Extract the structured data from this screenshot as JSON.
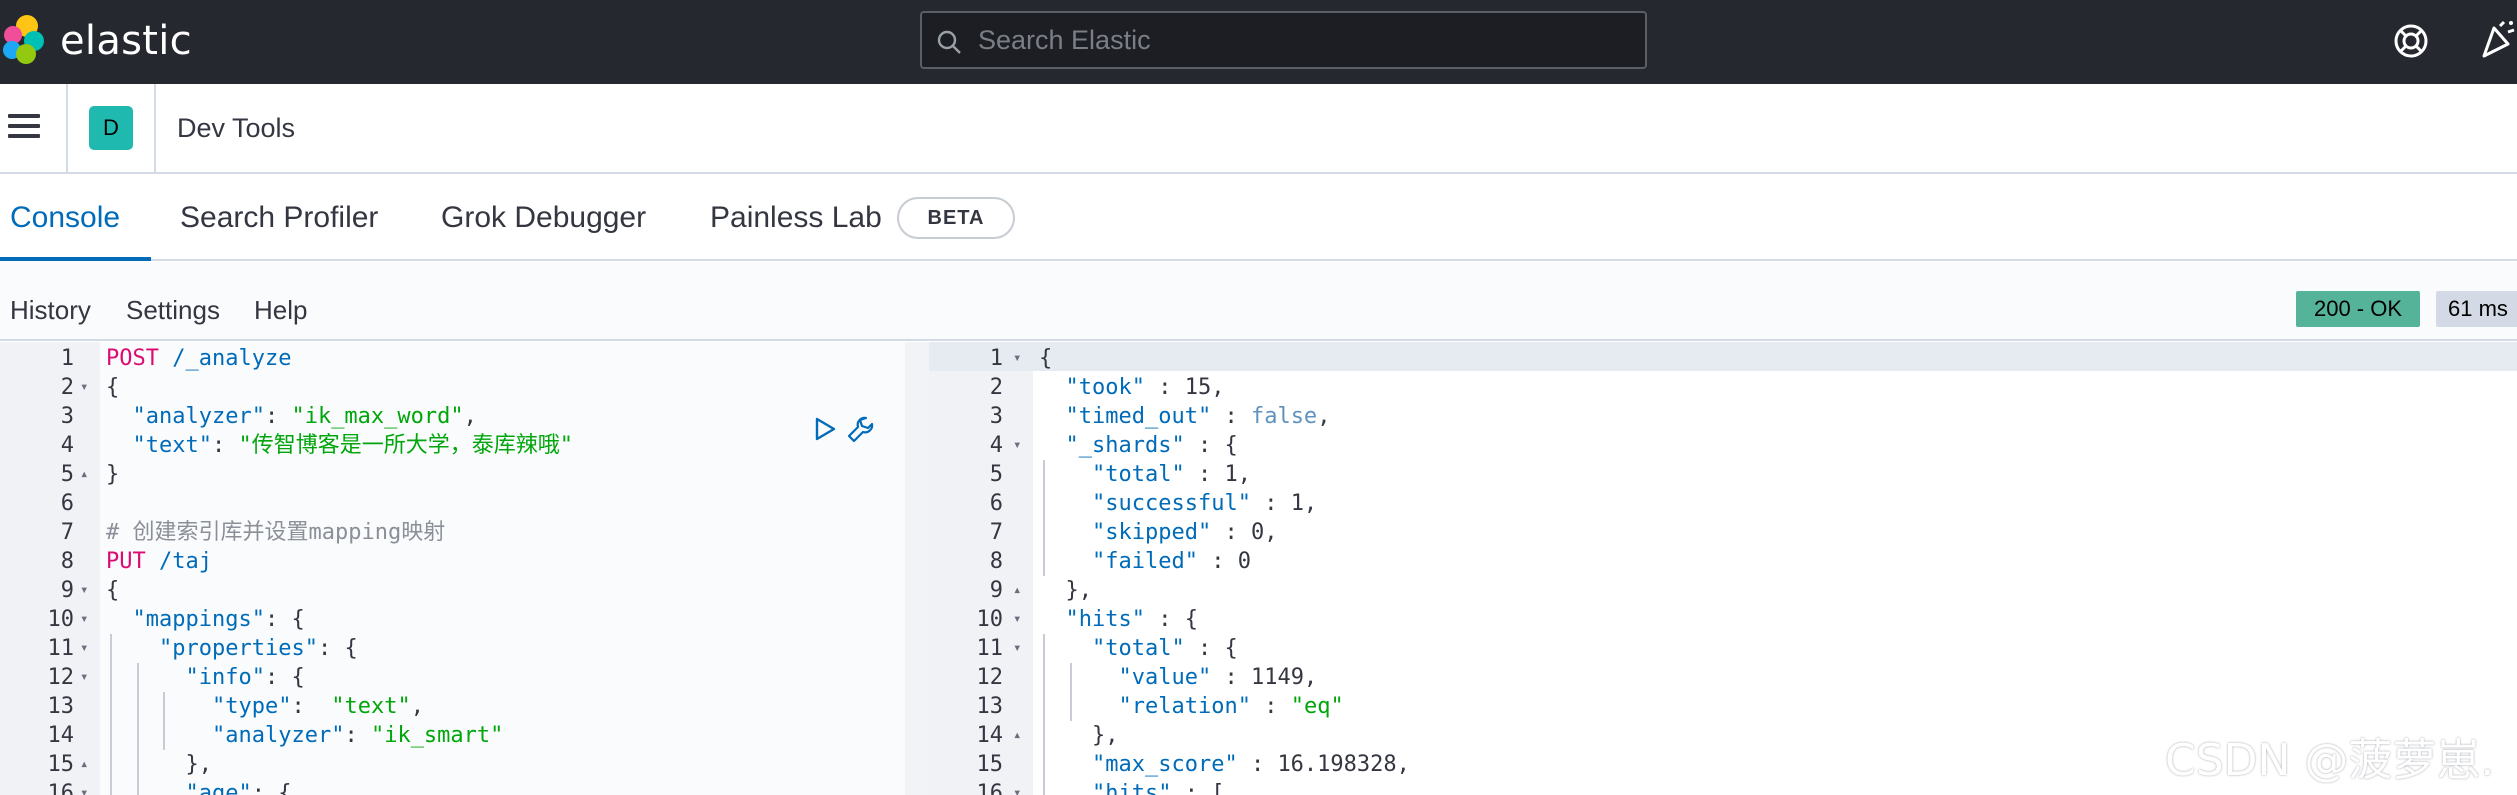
{
  "header": {
    "brand": "elastic",
    "search_placeholder": "Search Elastic"
  },
  "breadcrumb": {
    "space_initial": "D",
    "title": "Dev Tools"
  },
  "tabs": [
    {
      "label": "Console",
      "active": true
    },
    {
      "label": "Search Profiler",
      "active": false
    },
    {
      "label": "Grok Debugger",
      "active": false
    },
    {
      "label": "Painless Lab",
      "active": false,
      "badge": "BETA"
    }
  ],
  "toolbar": {
    "history": "History",
    "settings": "Settings",
    "help": "Help",
    "status": "200 - OK",
    "time": "61 ms"
  },
  "request_lines": [
    {
      "n": "1",
      "fold": "",
      "indent": 0,
      "parts": [
        [
          "kw",
          "POST"
        ],
        [
          "n",
          " "
        ],
        [
          "url",
          "/_analyze"
        ]
      ]
    },
    {
      "n": "2",
      "fold": "open",
      "indent": 0,
      "parts": [
        [
          "b",
          "{"
        ]
      ]
    },
    {
      "n": "3",
      "fold": "",
      "indent": 1,
      "parts": [
        [
          "k",
          "\"analyzer\""
        ],
        [
          "n",
          ": "
        ],
        [
          "s",
          "\"ik_max_word\""
        ],
        [
          "n",
          ","
        ]
      ]
    },
    {
      "n": "4",
      "fold": "",
      "indent": 1,
      "parts": [
        [
          "k",
          "\"text\""
        ],
        [
          "n",
          ": "
        ],
        [
          "s",
          "\"传智博客是一所大学，泰库辣哦\""
        ]
      ]
    },
    {
      "n": "5",
      "fold": "close",
      "indent": 0,
      "parts": [
        [
          "b",
          "}"
        ]
      ]
    },
    {
      "n": "6",
      "fold": "",
      "indent": 0,
      "parts": []
    },
    {
      "n": "7",
      "fold": "",
      "indent": 0,
      "parts": [
        [
          "cmt",
          "# 创建索引库并设置mapping映射"
        ]
      ]
    },
    {
      "n": "8",
      "fold": "",
      "indent": 0,
      "parts": [
        [
          "kw",
          "PUT"
        ],
        [
          "n",
          " "
        ],
        [
          "url",
          "/taj"
        ]
      ]
    },
    {
      "n": "9",
      "fold": "open",
      "indent": 0,
      "parts": [
        [
          "b",
          "{"
        ]
      ]
    },
    {
      "n": "10",
      "fold": "open",
      "indent": 1,
      "parts": [
        [
          "k",
          "\"mappings\""
        ],
        [
          "n",
          ": {"
        ]
      ]
    },
    {
      "n": "11",
      "fold": "open",
      "indent": 2,
      "parts": [
        [
          "k",
          "\"properties\""
        ],
        [
          "n",
          ": {"
        ]
      ]
    },
    {
      "n": "12",
      "fold": "open",
      "indent": 3,
      "parts": [
        [
          "k",
          "\"info\""
        ],
        [
          "n",
          ": {"
        ]
      ]
    },
    {
      "n": "13",
      "fold": "",
      "indent": 4,
      "parts": [
        [
          "k",
          "\"type\""
        ],
        [
          "n",
          ":  "
        ],
        [
          "s",
          "\"text\""
        ],
        [
          "n",
          ","
        ]
      ]
    },
    {
      "n": "14",
      "fold": "",
      "indent": 4,
      "parts": [
        [
          "k",
          "\"analyzer\""
        ],
        [
          "n",
          ": "
        ],
        [
          "s",
          "\"ik_smart\""
        ]
      ]
    },
    {
      "n": "15",
      "fold": "close",
      "indent": 3,
      "parts": [
        [
          "n",
          "},"
        ]
      ]
    },
    {
      "n": "16",
      "fold": "open",
      "indent": 3,
      "parts": [
        [
          "k",
          "\"age\""
        ],
        [
          "n",
          ": {"
        ]
      ]
    }
  ],
  "response_lines": [
    {
      "n": "1",
      "fold": "open",
      "indent": 0,
      "parts": [
        [
          "b",
          "{"
        ]
      ]
    },
    {
      "n": "2",
      "fold": "",
      "indent": 1,
      "parts": [
        [
          "k",
          "\"took\""
        ],
        [
          "n",
          " : 15,"
        ]
      ]
    },
    {
      "n": "3",
      "fold": "",
      "indent": 1,
      "parts": [
        [
          "k",
          "\"timed_out\""
        ],
        [
          "n",
          " : "
        ],
        [
          "bool",
          "false"
        ],
        [
          "n",
          ","
        ]
      ]
    },
    {
      "n": "4",
      "fold": "open",
      "indent": 1,
      "parts": [
        [
          "k",
          "\"_shards\""
        ],
        [
          "n",
          " : {"
        ]
      ]
    },
    {
      "n": "5",
      "fold": "",
      "indent": 2,
      "parts": [
        [
          "k",
          "\"total\""
        ],
        [
          "n",
          " : 1,"
        ]
      ]
    },
    {
      "n": "6",
      "fold": "",
      "indent": 2,
      "parts": [
        [
          "k",
          "\"successful\""
        ],
        [
          "n",
          " : 1,"
        ]
      ]
    },
    {
      "n": "7",
      "fold": "",
      "indent": 2,
      "parts": [
        [
          "k",
          "\"skipped\""
        ],
        [
          "n",
          " : 0,"
        ]
      ]
    },
    {
      "n": "8",
      "fold": "",
      "indent": 2,
      "parts": [
        [
          "k",
          "\"failed\""
        ],
        [
          "n",
          " : 0"
        ]
      ]
    },
    {
      "n": "9",
      "fold": "close",
      "indent": 1,
      "parts": [
        [
          "n",
          "},"
        ]
      ]
    },
    {
      "n": "10",
      "fold": "open",
      "indent": 1,
      "parts": [
        [
          "k",
          "\"hits\""
        ],
        [
          "n",
          " : {"
        ]
      ]
    },
    {
      "n": "11",
      "fold": "open",
      "indent": 2,
      "parts": [
        [
          "k",
          "\"total\""
        ],
        [
          "n",
          " : {"
        ]
      ]
    },
    {
      "n": "12",
      "fold": "",
      "indent": 3,
      "parts": [
        [
          "k",
          "\"value\""
        ],
        [
          "n",
          " : 1149,"
        ]
      ]
    },
    {
      "n": "13",
      "fold": "",
      "indent": 3,
      "parts": [
        [
          "k",
          "\"relation\""
        ],
        [
          "n",
          " : "
        ],
        [
          "s",
          "\"eq\""
        ]
      ]
    },
    {
      "n": "14",
      "fold": "close",
      "indent": 2,
      "parts": [
        [
          "n",
          "},"
        ]
      ]
    },
    {
      "n": "15",
      "fold": "",
      "indent": 2,
      "parts": [
        [
          "k",
          "\"max_score\""
        ],
        [
          "n",
          " : 16.198328,"
        ]
      ]
    },
    {
      "n": "16",
      "fold": "open",
      "indent": 2,
      "parts": [
        [
          "k",
          "\"hits\""
        ],
        [
          "n",
          " : ["
        ]
      ]
    }
  ],
  "watermark": "CSDN @菠萝崽."
}
